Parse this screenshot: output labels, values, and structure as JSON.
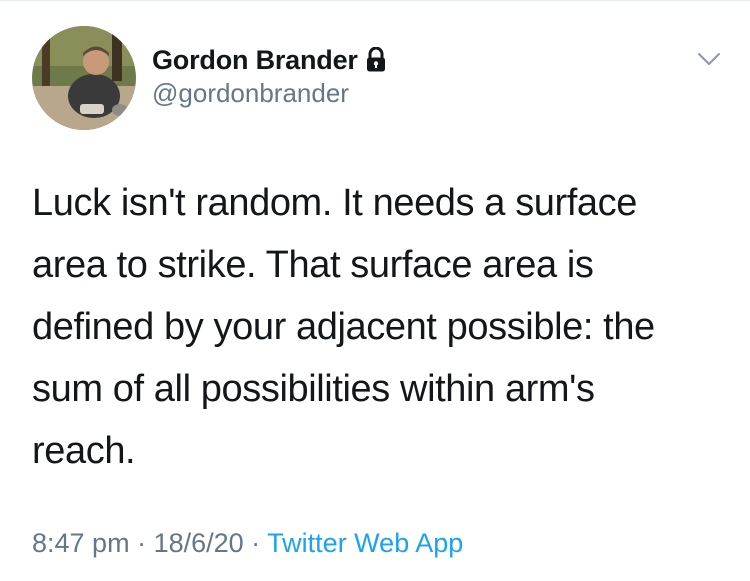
{
  "author": {
    "display_name": "Gordon Brander",
    "handle": "@gordonbrander",
    "protected_icon": "lock-icon",
    "avatar_alt": "avatar"
  },
  "menu": {
    "icon": "chevron-down-icon"
  },
  "tweet": {
    "text": "Luck isn't random. It needs a surface\narea to strike. That surface area is\ndefined by your adjacent possible: the\nsum of all possibilities within arm's\nreach."
  },
  "meta": {
    "time": "8:47 pm",
    "separator": " · ",
    "date": "18/6/20",
    "source": "Twitter Web App"
  },
  "colors": {
    "text": "#14171a",
    "secondary": "#657786",
    "link": "#1da1f2",
    "border": "#e6ecf0"
  }
}
